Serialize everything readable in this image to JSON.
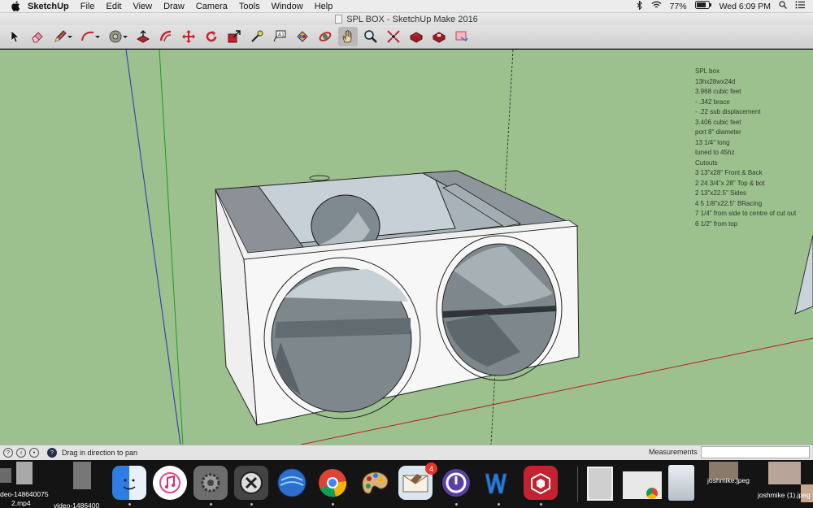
{
  "menubar": {
    "app_name": "SketchUp",
    "items": [
      "File",
      "Edit",
      "View",
      "Draw",
      "Camera",
      "Tools",
      "Window",
      "Help"
    ],
    "battery": "77%",
    "clock": "Wed 6:09 PM"
  },
  "window": {
    "title": "SPL BOX - SketchUp Make 2016"
  },
  "toolbar": {
    "tools": [
      {
        "name": "select-tool",
        "icon": "arrow-cursor-icon"
      },
      {
        "name": "eraser-tool",
        "icon": "eraser-icon"
      },
      {
        "name": "line-tool",
        "icon": "pencil-icon"
      },
      {
        "name": "arc-tool",
        "icon": "arc-icon"
      },
      {
        "name": "shapes-tool",
        "icon": "circle-shape-icon"
      },
      {
        "name": "push-pull-tool",
        "icon": "push-pull-icon"
      },
      {
        "name": "offset-tool",
        "icon": "offset-icon"
      },
      {
        "name": "move-tool",
        "icon": "move-arrows-icon"
      },
      {
        "name": "rotate-tool",
        "icon": "rotate-icon"
      },
      {
        "name": "scale-tool",
        "icon": "scale-icon"
      },
      {
        "name": "tape-measure-tool",
        "icon": "tape-measure-icon"
      },
      {
        "name": "text-tool",
        "icon": "text-icon"
      },
      {
        "name": "paint-bucket-tool",
        "icon": "paint-bucket-icon"
      },
      {
        "name": "orbit-tool",
        "icon": "orbit-icon"
      },
      {
        "name": "pan-tool",
        "icon": "hand-icon"
      },
      {
        "name": "zoom-tool",
        "icon": "magnifier-icon"
      },
      {
        "name": "zoom-extents-tool",
        "icon": "zoom-extents-icon"
      },
      {
        "name": "warehouse-tool",
        "icon": "3d-warehouse-icon"
      },
      {
        "name": "extension-warehouse-tool",
        "icon": "extension-warehouse-icon"
      },
      {
        "name": "send-to-layout-tool",
        "icon": "layout-icon"
      }
    ]
  },
  "notes": [
    "SPL box",
    "13hx28wx24d",
    "3.968 cubic feet",
    "- .342 brace",
    "- .22 sub displacement",
    "3.406 cubic feet",
    "port 8\" diameter",
    "13 1/4\" long",
    "tuned to 45hz",
    "Cutouts",
    "3 13\"x28\" Front & Back",
    "2 24 3/4\"x 28\" Top & bot",
    " 2 13\"x22.5\" Sides",
    " 4 5 1/8\"x22.5\" BRacing",
    "7 1/4\" from side to centre of cut out",
    "6 1/2\" from top"
  ],
  "statusbar": {
    "hint": "Drag in direction to pan",
    "measurements_label": "Measurements",
    "measurements_value": ""
  },
  "dock": {
    "left_files": [
      "deo-148640075",
      "2.mp4",
      "video-1486400"
    ],
    "right_files": [
      "joshmike.jpeg",
      "joshmike (1).jpeg"
    ],
    "mail_badge": "4",
    "apps": [
      "finder",
      "itunes",
      "system-preferences",
      "crossover",
      "google-earth",
      "chrome",
      "paintbrush",
      "mail",
      "bittorrent",
      "word",
      "sketchup"
    ]
  },
  "colors": {
    "viewport_bg": "#9cc08e",
    "box_face": "#f7f7f7",
    "interior_gray": "#8e969b",
    "axis_blue": "#2233bb",
    "axis_green": "#1c9c1c",
    "axis_red": "#b82222"
  }
}
